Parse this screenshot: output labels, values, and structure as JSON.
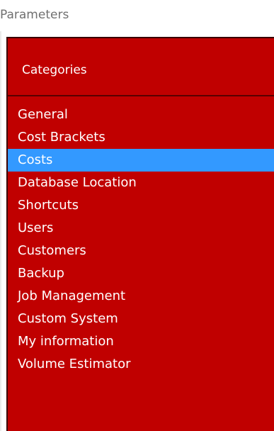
{
  "window": {
    "title": "Parameters"
  },
  "panel": {
    "header": "Categories",
    "selected_index": 2,
    "items": [
      {
        "label": "General"
      },
      {
        "label": "Cost Brackets"
      },
      {
        "label": "Costs"
      },
      {
        "label": "Database Location"
      },
      {
        "label": "Shortcuts"
      },
      {
        "label": "Users"
      },
      {
        "label": "Customers"
      },
      {
        "label": "Backup"
      },
      {
        "label": "Job Management"
      },
      {
        "label": "Custom System"
      },
      {
        "label": "My information"
      },
      {
        "label": "Volume Estimator"
      }
    ]
  },
  "colors": {
    "panel_background": "#c00000",
    "selection_highlight": "#3399ff",
    "item_text": "#ffffff",
    "title_text": "#707070"
  }
}
